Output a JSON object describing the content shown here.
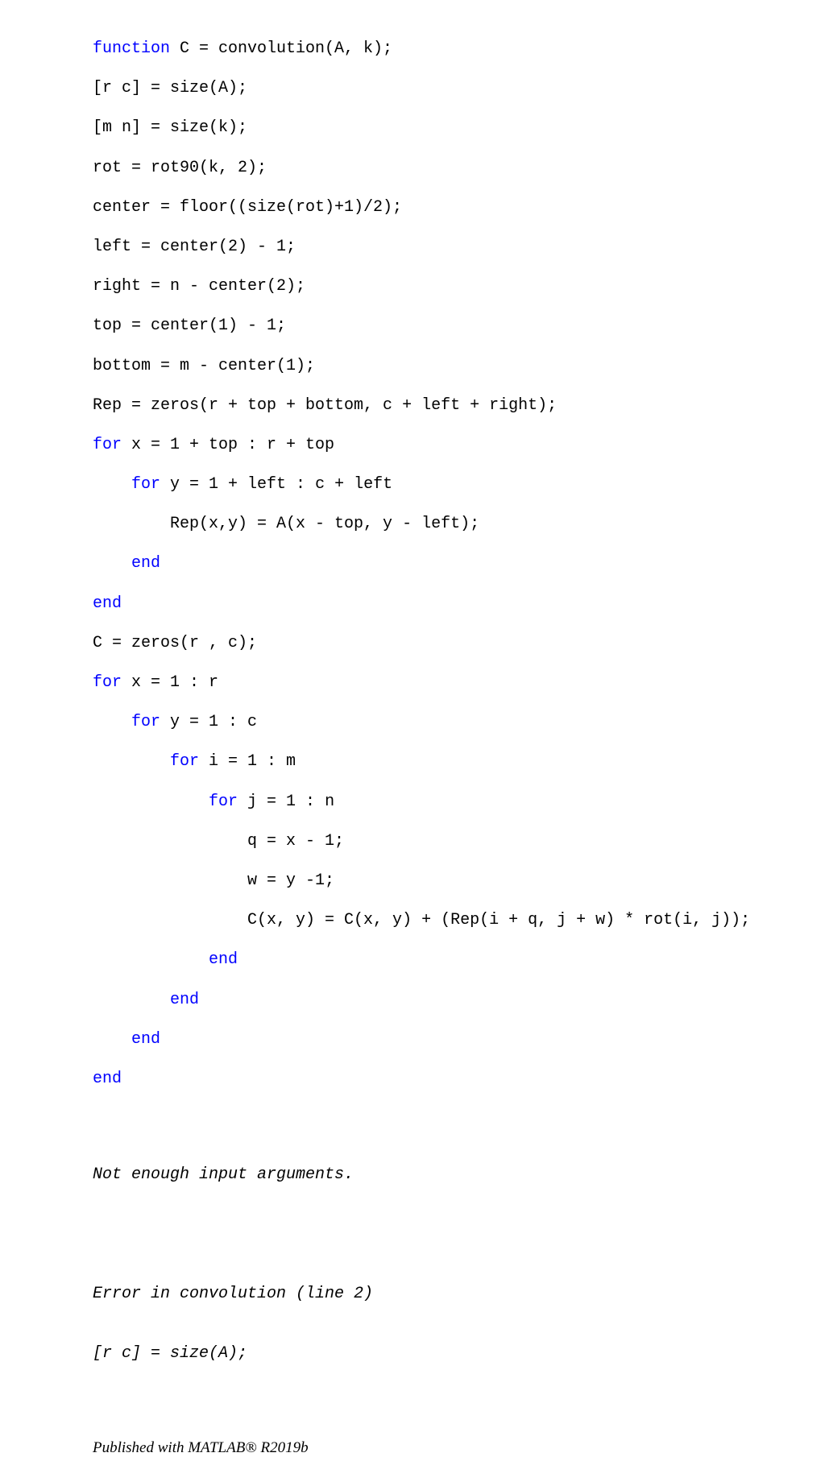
{
  "document": {
    "kind": "matlab-published-code",
    "background_color": "#ffffff",
    "text_color": "#000000",
    "keyword_color": "#0000ff"
  },
  "code": {
    "language": "MATLAB",
    "lines": [
      {
        "keyword": "function",
        "rest": " C = convolution(A, k);",
        "indent": ""
      },
      {
        "keyword": "",
        "rest": "[r c] = size(A);",
        "indent": ""
      },
      {
        "keyword": "",
        "rest": "[m n] = size(k);",
        "indent": ""
      },
      {
        "keyword": "",
        "rest": "rot = rot90(k, 2);",
        "indent": ""
      },
      {
        "keyword": "",
        "rest": "center = floor((size(rot)+1)/2);",
        "indent": ""
      },
      {
        "keyword": "",
        "rest": "left = center(2) - 1;",
        "indent": ""
      },
      {
        "keyword": "",
        "rest": "right = n - center(2);",
        "indent": ""
      },
      {
        "keyword": "",
        "rest": "top = center(1) - 1;",
        "indent": ""
      },
      {
        "keyword": "",
        "rest": "bottom = m - center(1);",
        "indent": ""
      },
      {
        "keyword": "",
        "rest": "Rep = zeros(r + top + bottom, c + left + right);",
        "indent": ""
      },
      {
        "keyword": "for",
        "rest": " x = 1 + top : r + top",
        "indent": ""
      },
      {
        "keyword": "for",
        "rest": " y = 1 + left : c + left",
        "indent": "    "
      },
      {
        "keyword": "",
        "rest": "Rep(x,y) = A(x - top, y - left);",
        "indent": "        "
      },
      {
        "keyword": "end",
        "rest": "",
        "indent": "    "
      },
      {
        "keyword": "end",
        "rest": "",
        "indent": ""
      },
      {
        "keyword": "",
        "rest": "C = zeros(r , c);",
        "indent": ""
      },
      {
        "keyword": "for",
        "rest": " x = 1 : r",
        "indent": ""
      },
      {
        "keyword": "for",
        "rest": " y = 1 : c",
        "indent": "    "
      },
      {
        "keyword": "for",
        "rest": " i = 1 : m",
        "indent": "        "
      },
      {
        "keyword": "for",
        "rest": " j = 1 : n",
        "indent": "            "
      },
      {
        "keyword": "",
        "rest": "q = x - 1;",
        "indent": "                "
      },
      {
        "keyword": "",
        "rest": "w = y -1;",
        "indent": "                "
      },
      {
        "keyword": "",
        "rest": "C(x, y) = C(x, y) + (Rep(i + q, j + w) * rot(i, j));",
        "indent": "                "
      },
      {
        "keyword": "end",
        "rest": "",
        "indent": "            "
      },
      {
        "keyword": "end",
        "rest": "",
        "indent": "        "
      },
      {
        "keyword": "end",
        "rest": "",
        "indent": "    "
      },
      {
        "keyword": "end",
        "rest": "",
        "indent": ""
      }
    ]
  },
  "error_output": {
    "message": "Not enough input arguments.",
    "blank": "",
    "location": "Error in convolution (line 2)",
    "source_line": "[r c] = size(A);"
  },
  "footer": {
    "text": "Published with MATLAB® R2019b"
  }
}
